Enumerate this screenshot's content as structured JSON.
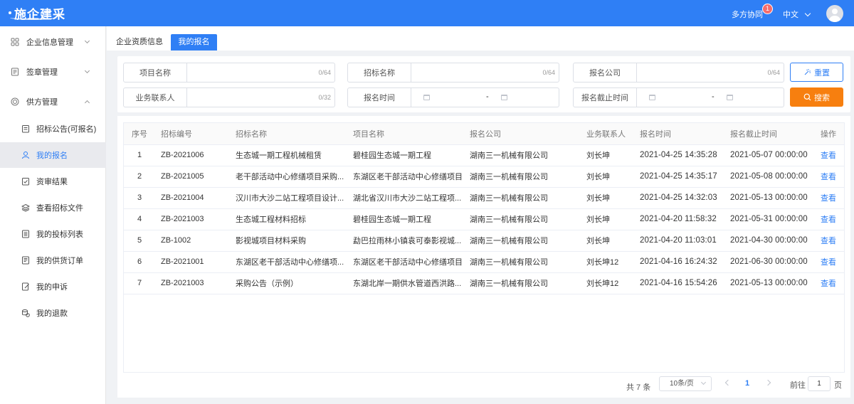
{
  "app": {
    "logo_text": "施企建采",
    "collab_label": "多方协同",
    "collab_badge": "1",
    "language": "中文"
  },
  "sidebar": {
    "items": [
      {
        "label": "企业信息管理",
        "icon": "grid-icon"
      },
      {
        "label": "签章管理",
        "icon": "document-icon"
      },
      {
        "label": "供方管理",
        "icon": "target-icon"
      },
      {
        "label": "招标公告(可报名)",
        "icon": "clipboard-icon"
      },
      {
        "label": "我的报名",
        "icon": "user-icon"
      },
      {
        "label": "资审结果",
        "icon": "check-clipboard-icon"
      },
      {
        "label": "查看招标文件",
        "icon": "layers-icon"
      },
      {
        "label": "我的投标列表",
        "icon": "list-icon"
      },
      {
        "label": "我的供货订单",
        "icon": "order-icon"
      },
      {
        "label": "我的申诉",
        "icon": "edit-icon"
      },
      {
        "label": "我的退款",
        "icon": "coins-icon"
      }
    ]
  },
  "tabs": {
    "tab1": "企业资质信息",
    "tab2": "我的报名"
  },
  "filters": {
    "project_name": {
      "label": "项目名称",
      "count": "0/64"
    },
    "tender_name": {
      "label": "招标名称",
      "count": "0/64"
    },
    "company": {
      "label": "报名公司",
      "count": "0/64"
    },
    "contact": {
      "label": "业务联系人",
      "count": "0/32"
    },
    "signup_time": {
      "label": "报名时间",
      "separator": "-"
    },
    "deadline": {
      "label": "报名截止时间",
      "separator": "-"
    },
    "reset_label": "重置",
    "search_label": "搜索"
  },
  "table": {
    "headers": [
      "序号",
      "招标编号",
      "招标名称",
      "项目名称",
      "报名公司",
      "业务联系人",
      "报名时间",
      "报名截止时间",
      "操作"
    ],
    "rows": [
      {
        "no": "1",
        "code": "ZB-2021006",
        "tender": "生态城一期工程机械租赁",
        "project": "碧桂园生态城一期工程",
        "company": "湖南三一机械有限公司",
        "contact": "刘长坤",
        "time": "2021-04-25 14:35:28",
        "deadline": "2021-05-07 00:00:00",
        "action": "查看"
      },
      {
        "no": "2",
        "code": "ZB-2021005",
        "tender": "老干部活动中心修缮项目采购...",
        "project": "东湖区老干部活动中心修缮项目",
        "company": "湖南三一机械有限公司",
        "contact": "刘长坤",
        "time": "2021-04-25 14:35:17",
        "deadline": "2021-05-08 00:00:00",
        "action": "查看"
      },
      {
        "no": "3",
        "code": "ZB-2021004",
        "tender": "汉川市大沙二站工程项目设计...",
        "project": "湖北省汉川市大沙二站工程项...",
        "company": "湖南三一机械有限公司",
        "contact": "刘长坤",
        "time": "2021-04-25 14:32:03",
        "deadline": "2021-05-13 00:00:00",
        "action": "查看"
      },
      {
        "no": "4",
        "code": "ZB-2021003",
        "tender": "生态城工程材料招标",
        "project": "碧桂园生态城一期工程",
        "company": "湖南三一机械有限公司",
        "contact": "刘长坤",
        "time": "2021-04-20 11:58:32",
        "deadline": "2021-05-31 00:00:00",
        "action": "查看"
      },
      {
        "no": "5",
        "code": "ZB-1002",
        "tender": "影视城项目材料采购",
        "project": "勐巴拉雨林小镇袁可泰影视城...",
        "company": "湖南三一机械有限公司",
        "contact": "刘长坤",
        "time": "2021-04-20 11:03:01",
        "deadline": "2021-04-30 00:00:00",
        "action": "查看"
      },
      {
        "no": "6",
        "code": "ZB-2021001",
        "tender": "东湖区老干部活动中心修缮项...",
        "project": "东湖区老干部活动中心修缮项目",
        "company": "湖南三一机械有限公司",
        "contact": "刘长坤12",
        "time": "2021-04-16 16:24:32",
        "deadline": "2021-06-30 00:00:00",
        "action": "查看"
      },
      {
        "no": "7",
        "code": "ZB-2021003",
        "tender": "采购公告（示例）",
        "project": "东湖北岸一期供水管道西洪路...",
        "company": "湖南三一机械有限公司",
        "contact": "刘长坤12",
        "time": "2021-04-16 15:54:26",
        "deadline": "2021-05-13 00:00:00",
        "action": "查看"
      }
    ]
  },
  "pagination": {
    "total": "共 7 条",
    "page_size": "10条/页",
    "current": "1",
    "goto_label": "前往",
    "goto_value": "1",
    "page_suffix": "页"
  },
  "colors": {
    "primary": "#2f7ff5",
    "search": "#f77f0f",
    "badge": "#f56c6c"
  }
}
